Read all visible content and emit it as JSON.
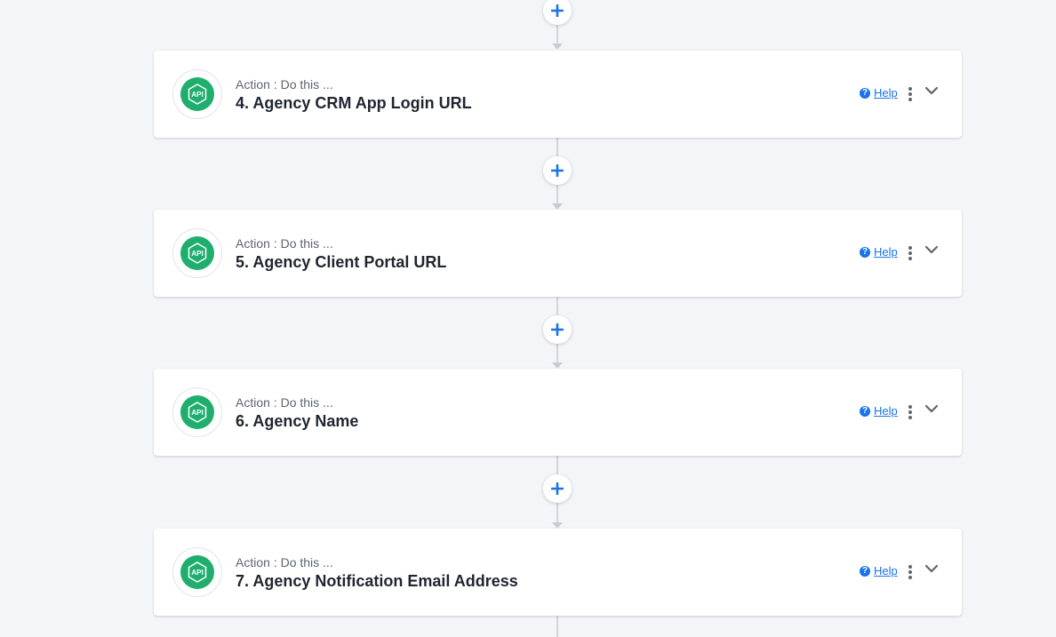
{
  "colors": {
    "accent": "#1a73e8",
    "brand_green": "#1fae6e",
    "background": "#f3f5f8"
  },
  "icons": {
    "add": "plus-icon",
    "app": "api-icon",
    "help": "question-circle-icon",
    "menu": "kebab-menu-icon",
    "expand": "chevron-down-icon"
  },
  "steps": [
    {
      "subtitle": "Action : Do this ...",
      "title": "4. Agency CRM App Login URL",
      "help_label": "Help",
      "app_label": "API"
    },
    {
      "subtitle": "Action : Do this ...",
      "title": "5. Agency Client Portal URL",
      "help_label": "Help",
      "app_label": "API"
    },
    {
      "subtitle": "Action : Do this ...",
      "title": "6. Agency Name",
      "help_label": "Help",
      "app_label": "API"
    },
    {
      "subtitle": "Action : Do this ...",
      "title": "7. Agency Notification Email Address",
      "help_label": "Help",
      "app_label": "API"
    }
  ]
}
